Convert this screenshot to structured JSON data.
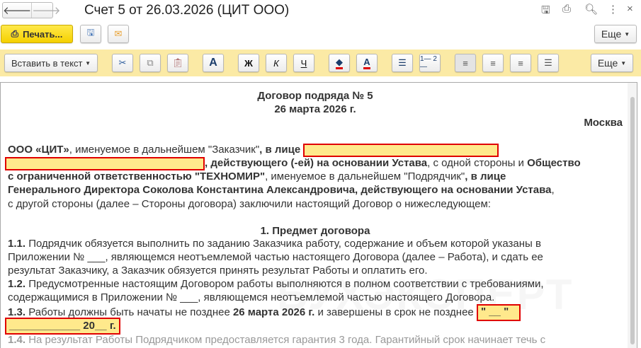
{
  "window": {
    "title": "Счет 5 от 26.03.2026 (ЦИТ ООО)",
    "back": "🡐",
    "forward": "🡒",
    "close": "×"
  },
  "toolbar": {
    "print_label": "Печать...",
    "more_label": "Еще"
  },
  "editor_toolbar": {
    "insert_label": "Вставить в текст",
    "bold": "Ж",
    "italic": "К",
    "underline": "Ч",
    "font": "A",
    "color": "A",
    "more_label": "Еще",
    "numbered": "1\n2"
  },
  "document": {
    "title": "Договор подряда № 5",
    "date": "26 марта 2026 г.",
    "city": "Москва",
    "watermark": "БУХЭКСПЕРТ",
    "p1": {
      "company": "ООО «ЦИТ»",
      "t1": ", именуемое в дальнейшем \"Заказчик\"",
      "t2": ", в лице",
      "t3": ", действующего (-ей) на основании Устава",
      "t4": ", с одной стороны и ",
      "t5": "Общество",
      "t6": "с ограниченной ответственностью \"ТЕХНОМИР\"",
      "t7": ", именуемое в дальнейшем \"Подрядчик\"",
      "t8": ", в лице",
      "t9": "Генерального Директора Соколова Константина Александровича, действующего на основании Устава",
      "t10": ",",
      "t11": "с другой стороны (далее – Стороны договора) заключили настоящий Договор о нижеследующем:"
    },
    "section1": "1. Предмет договора",
    "c11": {
      "num": "1.1.",
      "l1": " Подрядчик обязуется выполнить по заданию Заказчика работу, содержание и объем которой указаны в",
      "l2": "Приложении № ___, являющемся неотъемлемой частью настоящего Договора (далее – Работа), и сдать ее",
      "l3": "результат Заказчику, а Заказчик обязуется принять результат Работы и оплатить его."
    },
    "c12": {
      "num": "1.2.",
      "l1": " Предусмотренные настоящим Договором работы выполняются в полном соответствии с требованиями,",
      "l2": "содержащимися в Приложении № ___, являющемся неотъемлемой частью настоящего Договора."
    },
    "c13": {
      "num": "1.3.",
      "l1": " Работы должны быть начаты не позднее ",
      "date": "26 марта 2026 г.",
      "l2": " и завершены в срок не позднее ",
      "day": "\" __ \"",
      "month": "____________",
      "year": " 20__ г."
    },
    "c14": {
      "num": "1.4.",
      "l1": " На результат Работы Подрядчиком предоставляется гарантия 3 года. Гарантийный срок начинает течь с"
    }
  }
}
